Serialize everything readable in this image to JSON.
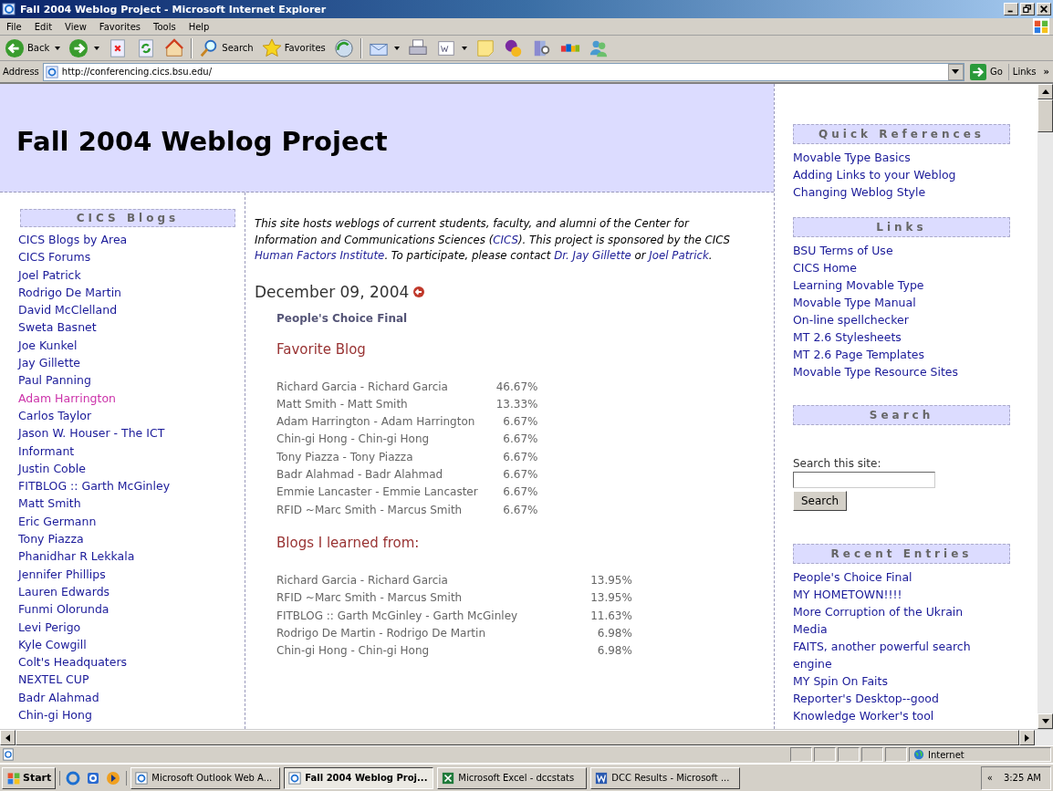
{
  "window": {
    "title": "Fall 2004 Weblog Project - Microsoft Internet Explorer"
  },
  "menu": [
    "File",
    "Edit",
    "View",
    "Favorites",
    "Tools",
    "Help"
  ],
  "toolbar": [
    {
      "kind": "back",
      "label": "Back",
      "dropdown": true
    },
    {
      "kind": "forward",
      "dropdown": true
    },
    {
      "kind": "stop"
    },
    {
      "kind": "refresh"
    },
    {
      "kind": "home"
    },
    {
      "kind": "separator"
    },
    {
      "kind": "search",
      "label": "Search"
    },
    {
      "kind": "favorites",
      "label": "Favorites"
    },
    {
      "kind": "media"
    },
    {
      "kind": "separator"
    },
    {
      "kind": "mail",
      "dropdown": true
    },
    {
      "kind": "print"
    },
    {
      "kind": "edit",
      "dropdown": true
    },
    {
      "kind": "note"
    },
    {
      "kind": "chat"
    },
    {
      "kind": "research"
    },
    {
      "kind": "auction"
    },
    {
      "kind": "people"
    }
  ],
  "address": {
    "label": "Address",
    "value": "http://conferencing.cics.bsu.edu/",
    "go": "Go",
    "links": "Links",
    "more": "»"
  },
  "page": {
    "site_title": "Fall 2004 Weblog Project",
    "blogs": {
      "heading": "CICS Blogs",
      "items": [
        {
          "label": "CICS Blogs by Area",
          "visited": false
        },
        {
          "label": "CICS Forums",
          "visited": false
        },
        {
          "label": "Joel Patrick",
          "visited": false
        },
        {
          "label": "Rodrigo De Martin",
          "visited": false
        },
        {
          "label": "David McClelland",
          "visited": false
        },
        {
          "label": "Sweta Basnet",
          "visited": false
        },
        {
          "label": "Joe Kunkel",
          "visited": false
        },
        {
          "label": "Jay Gillette",
          "visited": false
        },
        {
          "label": "Paul Panning",
          "visited": false
        },
        {
          "label": "Adam Harrington",
          "visited": true
        },
        {
          "label": "Carlos Taylor",
          "visited": false
        },
        {
          "label": "Jason W. Houser - The ICT Informant",
          "visited": false
        },
        {
          "label": "Justin Coble",
          "visited": false
        },
        {
          "label": "FITBLOG :: Garth McGinley",
          "visited": false
        },
        {
          "label": "Matt Smith",
          "visited": false
        },
        {
          "label": "Eric Germann",
          "visited": false
        },
        {
          "label": "Tony Piazza",
          "visited": false
        },
        {
          "label": "Phanidhar R Lekkala",
          "visited": false
        },
        {
          "label": "Jennifer Phillips",
          "visited": false
        },
        {
          "label": "Lauren Edwards",
          "visited": false
        },
        {
          "label": "Funmi Olorunda",
          "visited": false
        },
        {
          "label": "Levi Perigo",
          "visited": false
        },
        {
          "label": "Kyle Cowgill",
          "visited": false
        },
        {
          "label": "Colt's Headquaters",
          "visited": false
        },
        {
          "label": "NEXTEL CUP",
          "visited": false
        },
        {
          "label": "Badr Alahmad",
          "visited": false
        },
        {
          "label": "Chin-gi Hong",
          "visited": false
        }
      ]
    },
    "intro": [
      {
        "text": "This site hosts weblogs of current students, faculty, and alumni of the Center for Information and Communications Sciences (",
        "link": false
      },
      {
        "text": "CICS",
        "link": true
      },
      {
        "text": "). This project is sponsored by the CICS ",
        "link": false
      },
      {
        "text": "Human Factors Institute",
        "link": true
      },
      {
        "text": ". To participate, please contact ",
        "link": false
      },
      {
        "text": "Dr. Jay Gillette",
        "link": true
      },
      {
        "text": " or ",
        "link": false
      },
      {
        "text": "Joel Patrick",
        "link": true
      },
      {
        "text": ".",
        "link": false
      }
    ],
    "date": "December 09, 2004",
    "entry": {
      "title": "People's Choice Final",
      "sections": [
        {
          "heading": "Favorite Blog",
          "rows": [
            {
              "name": "Richard Garcia - Richard Garcia",
              "percent": "46.67%"
            },
            {
              "name": "Matt Smith - Matt Smith",
              "percent": "13.33%"
            },
            {
              "name": "Adam Harrington - Adam Harrington",
              "percent": "6.67%"
            },
            {
              "name": "Chin-gi Hong - Chin-gi Hong",
              "percent": "6.67%"
            },
            {
              "name": "Tony Piazza - Tony Piazza",
              "percent": "6.67%"
            },
            {
              "name": "Badr Alahmad - Badr Alahmad",
              "percent": "6.67%"
            },
            {
              "name": "Emmie Lancaster - Emmie Lancaster",
              "percent": "6.67%"
            },
            {
              "name": "RFID ~Marc Smith - Marcus Smith",
              "percent": "6.67%"
            }
          ]
        },
        {
          "heading": "Blogs I learned from:",
          "rows": [
            {
              "name": "Richard Garcia - Richard Garcia",
              "percent": "13.95%"
            },
            {
              "name": "RFID ~Marc Smith - Marcus Smith",
              "percent": "13.95%"
            },
            {
              "name": "FITBLOG :: Garth McGinley - Garth McGinley",
              "percent": "11.63%"
            },
            {
              "name": "Rodrigo De Martin - Rodrigo De Martin",
              "percent": "6.98%"
            },
            {
              "name": "Chin-gi Hong - Chin-gi Hong",
              "percent": "6.98%"
            }
          ]
        }
      ]
    },
    "quick_references": {
      "heading": "Quick References",
      "items": [
        "Movable Type Basics",
        "Adding Links to your Weblog",
        "Changing Weblog Style"
      ]
    },
    "links": {
      "heading": "Links",
      "items": [
        "BSU Terms of Use",
        "CICS Home",
        "Learning Movable Type",
        "Movable Type Manual",
        "On-line spellchecker",
        "MT 2.6 Stylesheets",
        "MT 2.6 Page Templates",
        "Movable Type Resource Sites"
      ]
    },
    "search": {
      "heading": "Search",
      "label": "Search this site:",
      "button": "Search"
    },
    "recent_entries": {
      "heading": "Recent Entries",
      "items": [
        "People's Choice Final",
        "MY HOMETOWN!!!!",
        "More Corruption of the Ukrain Media",
        "FAITS, another powerful search engine",
        "MY Spin On Faits",
        "Reporter's Desktop--good Knowledge Worker's tool"
      ]
    }
  },
  "status_bar": {
    "zone": "Internet"
  },
  "taskbar": {
    "start": "Start",
    "quick_launch": [
      {
        "kind": "browser"
      },
      {
        "kind": "outlook"
      },
      {
        "kind": "media"
      }
    ],
    "tasks": [
      {
        "label": "Microsoft Outlook Web A...",
        "kind": "browser",
        "selected": false
      },
      {
        "label": "Fall 2004 Weblog Proj...",
        "kind": "browser",
        "selected": true
      },
      {
        "label": "Microsoft Excel - dccstats",
        "kind": "excel",
        "selected": false
      },
      {
        "label": "DCC Results - Microsoft ...",
        "kind": "word",
        "selected": false
      }
    ],
    "expand": "«",
    "clock": "3:25 AM"
  }
}
